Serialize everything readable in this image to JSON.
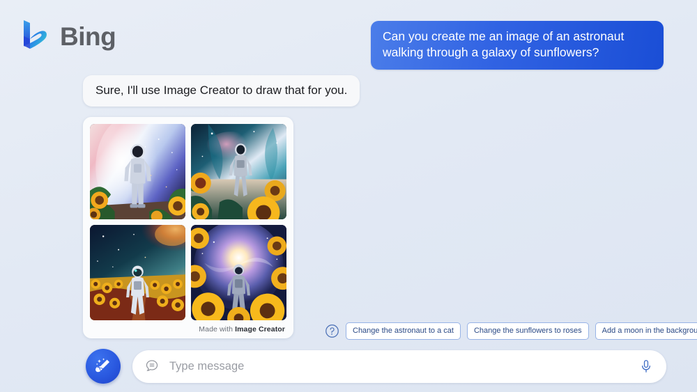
{
  "brand": {
    "logo_icon": "bing-logo-icon",
    "name": "Bing"
  },
  "conversation": {
    "user_message": "Can you create me an image of an astronaut walking through a galaxy of sunflowers?",
    "assistant_message": "Sure, I'll use Image Creator to draw that for you."
  },
  "image_results": {
    "attribution_prefix": "Made with ",
    "attribution_link": "Image Creator",
    "thumbnails": [
      {
        "alt": "Astronaut standing in sunflower field before a pink and blue nebula"
      },
      {
        "alt": "Astronaut walking toward a teal galaxy above large sunflowers"
      },
      {
        "alt": "Astronaut walking down a path through a sunflower field under an orange nebula"
      },
      {
        "alt": "Astronaut walking into a glowing spiral galaxy framed by sunflowers"
      }
    ]
  },
  "suggestions": {
    "help_icon": "question-mark-circle-icon",
    "chips": [
      "Change the astronaut to a cat",
      "Change the sunflowers to roses",
      "Add a moon in the background"
    ]
  },
  "composer": {
    "new_topic_icon": "broom-sparkle-icon",
    "message_icon": "chat-bubble-icon",
    "placeholder": "Type message",
    "value": "",
    "mic_icon": "microphone-icon"
  },
  "colors": {
    "page_background": "#e3e9f4",
    "user_bubble_start": "#4b7de9",
    "user_bubble_end": "#1a4ed6",
    "assistant_bubble": "#f7f8fa",
    "accent_blue": "#2a59e0",
    "chip_border": "#97b3e6",
    "chip_text": "#2b4a86"
  }
}
